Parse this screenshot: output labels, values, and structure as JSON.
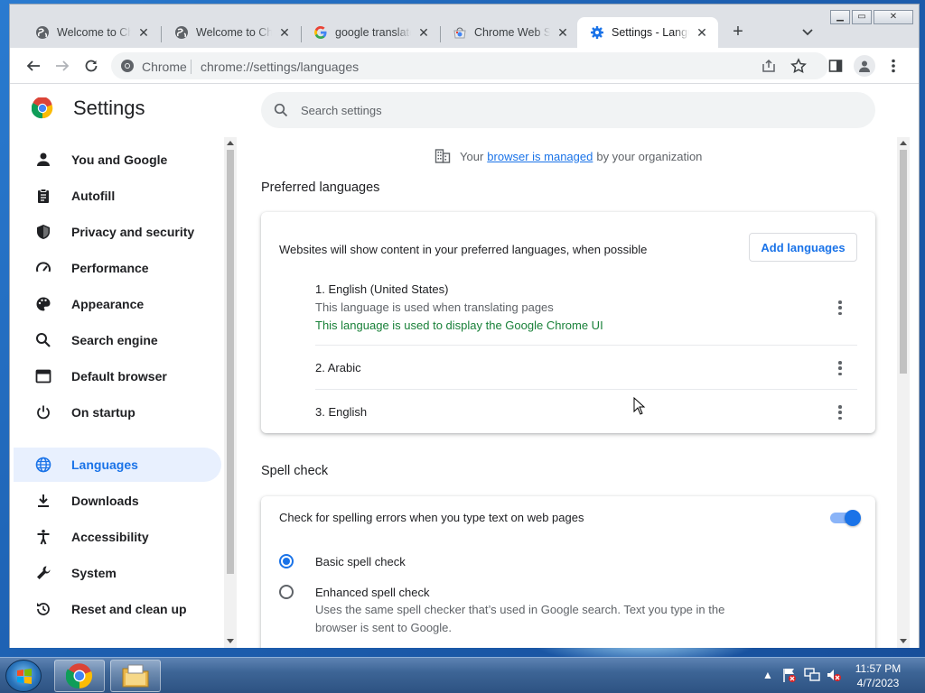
{
  "browser": {
    "tabs": [
      {
        "label": "Welcome to Chrome",
        "icon": "globe-icon",
        "active": false
      },
      {
        "label": "Welcome to Chrome",
        "icon": "globe-icon",
        "active": false
      },
      {
        "label": "google translate",
        "icon": "google-icon",
        "active": false
      },
      {
        "label": "Chrome Web Store",
        "icon": "web-store-icon",
        "active": false
      },
      {
        "label": "Settings - Languages",
        "icon": "gear-icon",
        "active": true
      }
    ],
    "new_tab": "+",
    "window_controls": [
      "minimize",
      "maximize",
      "close"
    ],
    "omnibox": {
      "site": "Chrome",
      "url": "chrome://settings/languages"
    }
  },
  "settings": {
    "title": "Settings",
    "search_placeholder": "Search settings",
    "nav": [
      {
        "label": "You and Google",
        "icon": "person-icon",
        "active": false
      },
      {
        "label": "Autofill",
        "icon": "clipboard-icon",
        "active": false
      },
      {
        "label": "Privacy and security",
        "icon": "shield-icon",
        "active": false
      },
      {
        "label": "Performance",
        "icon": "speedometer-icon",
        "active": false
      },
      {
        "label": "Appearance",
        "icon": "palette-icon",
        "active": false
      },
      {
        "label": "Search engine",
        "icon": "search-icon",
        "active": false
      },
      {
        "label": "Default browser",
        "icon": "browser-icon",
        "active": false
      },
      {
        "label": "On startup",
        "icon": "power-icon",
        "active": false
      },
      {
        "label": "Languages",
        "icon": "globe-icon",
        "active": true
      },
      {
        "label": "Downloads",
        "icon": "download-icon",
        "active": false
      },
      {
        "label": "Accessibility",
        "icon": "accessibility-icon",
        "active": false
      },
      {
        "label": "System",
        "icon": "wrench-icon",
        "active": false
      },
      {
        "label": "Reset and clean up",
        "icon": "reset-icon",
        "active": false
      }
    ],
    "managed": {
      "prefix": "Your",
      "link": "browser is managed",
      "suffix": "by your organization"
    },
    "preferred": {
      "title": "Preferred languages",
      "description": "Websites will show content in your preferred languages, when possible",
      "add_button": "Add languages",
      "languages": [
        {
          "name": "1. English (United States)",
          "note": "This language is used when translating pages",
          "ui_note": "This language is used to display the Google Chrome UI"
        },
        {
          "name": "2. Arabic"
        },
        {
          "name": "3. English"
        }
      ]
    },
    "spell": {
      "title": "Spell check",
      "toggle_label": "Check for spelling errors when you type text on web pages",
      "toggle_on": true,
      "options": [
        {
          "label": "Basic spell check",
          "selected": true,
          "note": ""
        },
        {
          "label": "Enhanced spell check",
          "selected": false,
          "note": "Uses the same spell checker that’s used in Google search. Text you type in the browser is sent to Google."
        }
      ]
    }
  },
  "taskbar": {
    "time": "11:57 PM",
    "date": "4/7/2023",
    "apps": [
      "chrome-icon",
      "file-explorer-icon"
    ]
  },
  "colors": {
    "accent": "#1a73e8",
    "green_note": "#188038",
    "active_nav_bg": "#e8f0fe"
  }
}
